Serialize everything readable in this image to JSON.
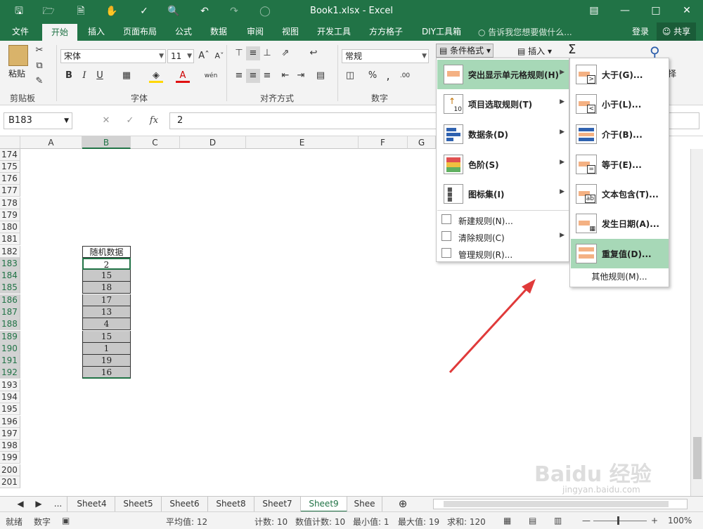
{
  "titlebar": {
    "title": "Book1.xlsx - Excel",
    "icons": [
      "save-icon",
      "open-icon",
      "new-icon",
      "touch-icon",
      "spell-icon",
      "preview-icon",
      "undo-icon",
      "redo-icon",
      "circle-icon"
    ]
  },
  "menu": {
    "tabs": [
      "文件",
      "开始",
      "插入",
      "页面布局",
      "公式",
      "数据",
      "审阅",
      "视图",
      "开发工具",
      "方方格子",
      "DIY工具箱"
    ],
    "active": "开始",
    "tellme": "告诉我您想要做什么...",
    "login": "登录",
    "share": "共享"
  },
  "ribbon": {
    "clipboard": {
      "label": "剪贴板",
      "paste": "粘贴"
    },
    "font": {
      "label": "字体",
      "name": "宋体",
      "size": "11"
    },
    "align": {
      "label": "对齐方式"
    },
    "number": {
      "label": "数字",
      "format": "常规"
    },
    "cond_format": "条件格式",
    "insert": "插入",
    "select": "择"
  },
  "formula_bar": {
    "namebox": "B183",
    "value": "2"
  },
  "columns": [
    "A",
    "B",
    "C",
    "D",
    "E",
    "F",
    "G"
  ],
  "rows": [
    "174",
    "175",
    "176",
    "177",
    "178",
    "179",
    "180",
    "181",
    "182",
    "183",
    "184",
    "185",
    "186",
    "187",
    "188",
    "189",
    "190",
    "191",
    "192",
    "193",
    "194",
    "195",
    "196",
    "197",
    "198",
    "199",
    "200",
    "201"
  ],
  "table": {
    "header": "随机数据",
    "values": [
      "2",
      "15",
      "18",
      "17",
      "13",
      "4",
      "15",
      "1",
      "19",
      "16"
    ]
  },
  "cond_menu": {
    "items": [
      {
        "label": "突出显示单元格规则(H)",
        "highlight": true
      },
      {
        "label": "项目选取规则(T)"
      },
      {
        "label": "数据条(D)"
      },
      {
        "label": "色阶(S)"
      },
      {
        "label": "图标集(I)"
      }
    ],
    "small": [
      "新建规则(N)...",
      "清除规则(C)",
      "管理规则(R)..."
    ]
  },
  "sub_menu": {
    "items": [
      {
        "label": "大于(G)...",
        "sym": ">"
      },
      {
        "label": "小于(L)...",
        "sym": "<"
      },
      {
        "label": "介于(B)...",
        "sym": ""
      },
      {
        "label": "等于(E)...",
        "sym": "="
      },
      {
        "label": "文本包含(T)...",
        "sym": "ab"
      },
      {
        "label": "发生日期(A)...",
        "sym": ""
      },
      {
        "label": "重复值(D)...",
        "sym": ""
      }
    ],
    "more": "其他规则(M)..."
  },
  "sheets": [
    "...",
    "Sheet4",
    "Sheet5",
    "Sheet6",
    "Sheet8",
    "Sheet7",
    "Sheet9",
    "Shee"
  ],
  "active_sheet": "Sheet9",
  "status": {
    "ready": "就绪",
    "mode": "数字",
    "avg": "平均值: 12",
    "count": "计数: 10",
    "numcount": "数值计数: 10",
    "min": "最小值: 1",
    "max": "最大值: 19",
    "sum": "求和: 120",
    "zoom": "100%"
  },
  "watermark": {
    "brand": "Baidu 经验",
    "url": "jingyan.baidu.com"
  },
  "colors": {
    "excel_green": "#217346",
    "highlight": "#a7d8b7",
    "arrow": "#e03a3a"
  }
}
